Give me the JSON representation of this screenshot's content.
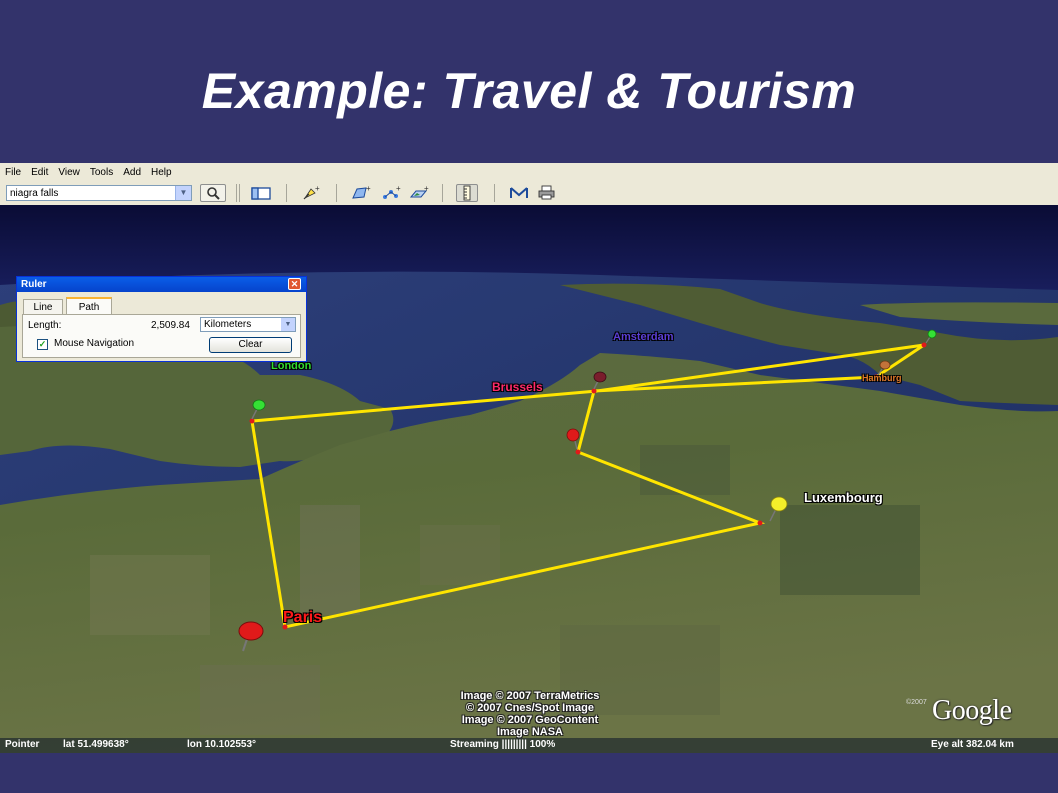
{
  "slide": {
    "title": "Example:  Travel & Tourism"
  },
  "menu": {
    "items": [
      "File",
      "Edit",
      "View",
      "Tools",
      "Add",
      "Help"
    ]
  },
  "search": {
    "value": "niagra falls"
  },
  "ruler": {
    "title": "Ruler",
    "tabs": [
      "Line",
      "Path"
    ],
    "active_tab": "Path",
    "length_label": "Length:",
    "length_value": "2,509.84",
    "units": "Kilometers",
    "mouse_navigation_label": "Mouse Navigation",
    "mouse_navigation_checked": true,
    "clear_label": "Clear"
  },
  "map": {
    "cities": [
      {
        "name": "London",
        "color": "#2fdc2f"
      },
      {
        "name": "Amsterdam",
        "color": "#5b3fd6"
      },
      {
        "name": "Brussels",
        "color": "#ff2a6a"
      },
      {
        "name": "Luxembourg",
        "color": "#ffffff"
      },
      {
        "name": "Paris",
        "color": "#ff1a1a"
      },
      {
        "name": "Hamburg",
        "color": "#e07a2a"
      }
    ],
    "path_color": "#ffe500"
  },
  "credits": [
    "Image © 2007 TerraMetrics",
    "© 2007 Cnes/Spot Image",
    "Image © 2007 GeoContent",
    "Image NASA"
  ],
  "logo": {
    "text": "Google",
    "year": "©2007"
  },
  "status": {
    "pointer_label": "Pointer",
    "lat": "lat   51.499638°",
    "lon": "lon   10.102553°",
    "streaming": "Streaming  |||||||||  100%",
    "eye_alt": "Eye alt   382.04 km"
  }
}
